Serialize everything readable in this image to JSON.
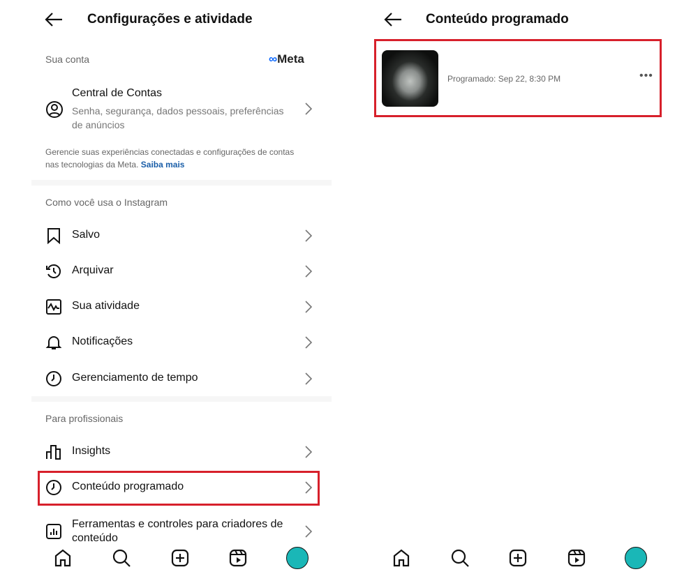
{
  "left": {
    "title": "Configurações e atividade",
    "account_section": {
      "label": "Sua conta",
      "brand": "Meta"
    },
    "accounts_center": {
      "title": "Central de Contas",
      "subtitle_line1": "Senha, segurança, dados pessoais, preferências",
      "subtitle_line2": "de anúncios"
    },
    "info_line1": "Gerencie suas experiências conectadas e configurações de contas",
    "info_line2": "nas tecnologias da Meta.",
    "learn_more": "Saiba mais",
    "usage_section": "Como você usa o Instagram",
    "usage_items": [
      {
        "label": "Salvo",
        "icon": "bookmark-icon"
      },
      {
        "label": "Arquivar",
        "icon": "archive-icon"
      },
      {
        "label": "Sua atividade",
        "icon": "activity-icon"
      },
      {
        "label": "Notificações",
        "icon": "bell-icon"
      },
      {
        "label": "Gerenciamento de tempo",
        "icon": "clock-icon"
      }
    ],
    "pro_section": "Para profissionais",
    "pro_items": [
      {
        "label": "Insights",
        "icon": "bar-chart-icon"
      },
      {
        "label": "Conteúdo programado",
        "icon": "clock-icon",
        "highlighted": true
      },
      {
        "label": "Ferramentas e controles para criadores de",
        "label2": "conteúdo",
        "icon": "creator-tools-icon"
      }
    ]
  },
  "right": {
    "title": "Conteúdo programado",
    "scheduled": [
      {
        "text": "Programado: Sep 22, 8:30 PM"
      }
    ]
  },
  "nav": [
    "home-icon",
    "search-icon",
    "create-icon",
    "reels-icon",
    "profile-avatar"
  ],
  "colors": {
    "highlight": "#d7202b",
    "link": "#1a5ea8",
    "avatar": "#1ab7b7"
  }
}
